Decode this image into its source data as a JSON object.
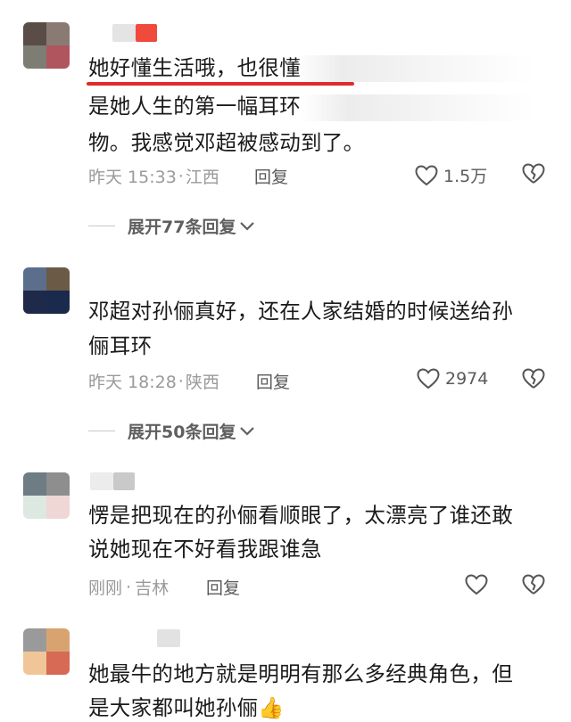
{
  "comments": [
    {
      "text_line1": "她好懂生活哦，也很懂",
      "text_line2": "是她人生的第一幅耳环",
      "text_line3": "物。我感觉邓超被感动到了。",
      "time": "昨天 15:33",
      "dot": "·",
      "location": "江西",
      "reply": "回复",
      "likes": "1.5万",
      "expand": "展开77条回复",
      "avatar_colors": [
        "#5a4d48",
        "#8a7a74",
        "#7d7d74",
        "#b0555e"
      ],
      "name_colors": [
        "#e4e4e4",
        "#ef4a3c"
      ]
    },
    {
      "text_line1": "邓超对孙俪真好，还在人家结婚的时候送给孙",
      "text_line2": "俪耳环",
      "time": "昨天 18:28",
      "dot": "·",
      "location": "陕西",
      "reply": "回复",
      "likes": "2974",
      "expand": "展开50条回复",
      "avatar_colors": [
        "#5b6e8c",
        "#6b5a46",
        "#1f2a4a",
        "#1a2a4c"
      ]
    },
    {
      "text_line1": "愣是把现在的孙俪看顺眼了，太漂亮了谁还敢",
      "text_line2": "说她现在不好看我跟谁急",
      "time": "刚刚",
      "dot": "·",
      "location": "吉林",
      "reply": "回复",
      "likes": "",
      "avatar_colors": [
        "#6e7c84",
        "#8e8e8e",
        "#dde8e2",
        "#efd7d6"
      ],
      "name_colors": [
        "#ececec",
        "#c9c9c9"
      ]
    },
    {
      "text_line1": "她最牛的地方就是明明有那么多经典角色，但",
      "text_line2": "是大家都叫她孙俪👍",
      "avatar_colors": [
        "#9a9a9a",
        "#d9a36f",
        "#f0c698",
        "#d66a55"
      ],
      "name_colors": [
        "#e2e2e2"
      ]
    }
  ],
  "colors": {
    "underline": "#e02b2b",
    "meta": "#9a9a9a",
    "reply": "#5a5a5a"
  }
}
